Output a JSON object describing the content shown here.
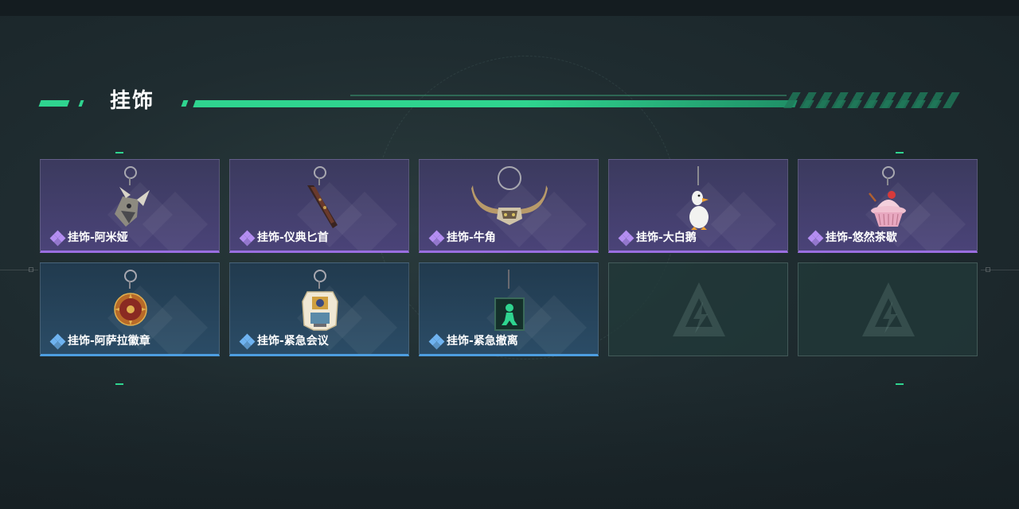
{
  "section": {
    "title": "挂饰",
    "accent_color": "#2fd48f"
  },
  "rarity_colors": {
    "purple": "#9a6ee0",
    "blue": "#4d9ee0"
  },
  "items": [
    {
      "label": "挂饰-阿米娅",
      "rarity": "purple",
      "icon": "amiya-charm-icon"
    },
    {
      "label": "挂饰-仪典匕首",
      "rarity": "purple",
      "icon": "ceremonial-dagger-charm-icon"
    },
    {
      "label": "挂饰-牛角",
      "rarity": "purple",
      "icon": "bull-horn-charm-icon"
    },
    {
      "label": "挂饰-大白鹅",
      "rarity": "purple",
      "icon": "white-goose-charm-icon"
    },
    {
      "label": "挂饰-悠然茶歇",
      "rarity": "purple",
      "icon": "cupcake-charm-icon"
    },
    {
      "label": "挂饰-阿萨拉徽章",
      "rarity": "blue",
      "icon": "asala-badge-charm-icon"
    },
    {
      "label": "挂饰-紧急会议",
      "rarity": "blue",
      "icon": "emergency-meeting-charm-icon"
    },
    {
      "label": "挂饰-紧急撤离",
      "rarity": "blue",
      "icon": "emergency-evac-charm-icon"
    },
    {
      "label": "",
      "rarity": "empty",
      "icon": "empty-slot-logo-icon"
    },
    {
      "label": "",
      "rarity": "empty",
      "icon": "empty-slot-logo-icon"
    }
  ]
}
